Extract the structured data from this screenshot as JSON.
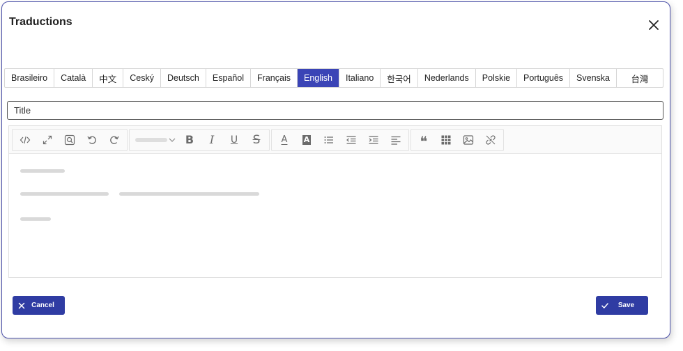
{
  "dialog": {
    "title": "Traductions",
    "close_icon": "close-icon"
  },
  "tabs": [
    {
      "label": "Brasileiro",
      "active": false
    },
    {
      "label": "Català",
      "active": false
    },
    {
      "label": "中文",
      "active": false
    },
    {
      "label": "Ceský",
      "active": false
    },
    {
      "label": "Deutsch",
      "active": false
    },
    {
      "label": "Español",
      "active": false
    },
    {
      "label": "Français",
      "active": false
    },
    {
      "label": "English",
      "active": true
    },
    {
      "label": "Italiano",
      "active": false
    },
    {
      "label": "한국어",
      "active": false
    },
    {
      "label": "Nederlands",
      "active": false
    },
    {
      "label": "Polskie",
      "active": false
    },
    {
      "label": "Português",
      "active": false
    },
    {
      "label": "Svenska",
      "active": false
    },
    {
      "label": "台灣",
      "active": false
    }
  ],
  "title_field": {
    "value": "",
    "placeholder": "Title"
  },
  "toolbar": {
    "groups": [
      [
        "code-view-icon",
        "fullscreen-icon",
        "preview-icon",
        "undo-icon",
        "redo-icon"
      ],
      [
        "font-family-select",
        "bold-icon",
        "italic-icon",
        "underline-icon",
        "strikethrough-icon"
      ],
      [
        "font-color-icon",
        "highlight-color-icon",
        "unordered-list-icon",
        "outdent-icon",
        "indent-icon",
        "align-left-icon"
      ],
      [
        "blockquote-icon",
        "table-icon",
        "image-icon",
        "unlink-icon"
      ]
    ],
    "glyphs": {
      "bold": "B",
      "italic": "I",
      "underline": "U",
      "strike": "S",
      "font_color": "A",
      "highlight": "A",
      "quote": "❝"
    }
  },
  "actions": {
    "cancel_label": "Cancel",
    "save_label": "Save"
  },
  "colors": {
    "accent": "#3a44b6",
    "button": "#2f3ca3",
    "dialog_border": "#4a4fa8"
  }
}
